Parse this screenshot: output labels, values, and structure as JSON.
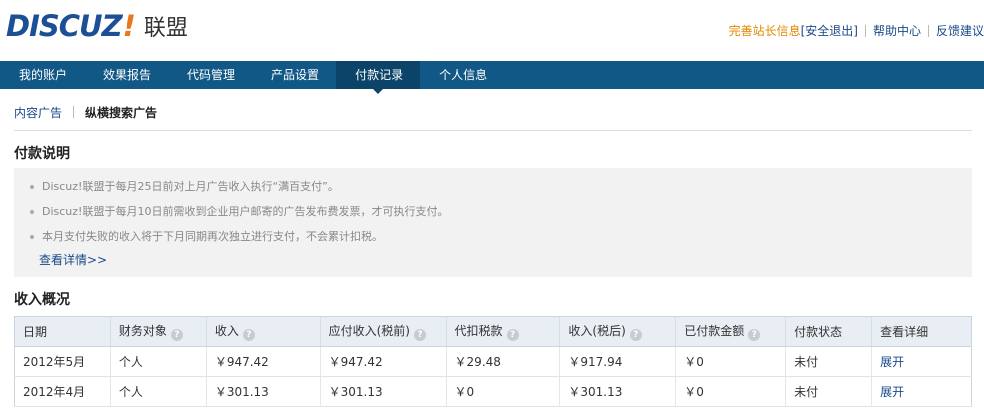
{
  "header": {
    "logo_word": "DISCUZ",
    "logo_excl": "!",
    "logo_cn": "联盟",
    "links": {
      "profile": "完善站长信息",
      "logout": "[安全退出]",
      "help": "帮助中心",
      "feedback": "反馈建议"
    }
  },
  "nav": {
    "items": [
      "我的账户",
      "效果报告",
      "代码管理",
      "产品设置",
      "付款记录",
      "个人信息"
    ],
    "active": "付款记录"
  },
  "subnav": {
    "items": [
      "内容广告",
      "纵横搜索广告"
    ],
    "current": "纵横搜索广告"
  },
  "payment_notes": {
    "title": "付款说明",
    "items": [
      "Discuz!联盟于每月25日前对上月广告收入执行“满百支付”。",
      "Discuz!联盟于每月10日前需收到企业用户邮寄的广告发布费发票，才可执行支付。",
      "本月支付失败的收入将于下月同期再次独立进行支付，不会累计扣税。"
    ],
    "more_link": "查看详情>>"
  },
  "income": {
    "title": "收入概况",
    "columns": [
      {
        "label": "日期",
        "help": false
      },
      {
        "label": "财务对象",
        "help": true
      },
      {
        "label": "收入",
        "help": true
      },
      {
        "label": "应付收入(税前)",
        "help": true
      },
      {
        "label": "代扣税款",
        "help": true
      },
      {
        "label": "收入(税后)",
        "help": true
      },
      {
        "label": "已付款金额",
        "help": true
      },
      {
        "label": "付款状态",
        "help": false
      },
      {
        "label": "查看详细",
        "help": false
      }
    ],
    "rows": [
      [
        "2012年5月",
        "个人",
        "￥947.42",
        "￥947.42",
        "￥29.48",
        "￥917.94",
        "￥0",
        "未付",
        "展开"
      ],
      [
        "2012年4月",
        "个人",
        "￥301.13",
        "￥301.13",
        "￥0",
        "￥301.13",
        "￥0",
        "未付",
        "展开"
      ]
    ]
  },
  "colors": {
    "nav_bg": "#115887",
    "nav_active": "#0b4468",
    "logo_blue": "#1c4f96",
    "logo_orange": "#e8781e",
    "link_blue": "#1a4a8a",
    "orange_link": "#e08a00"
  },
  "icons": {
    "help": "question-circle-icon",
    "bullet": "bullet-dot-icon",
    "nav_caret": "caret-down-icon"
  }
}
